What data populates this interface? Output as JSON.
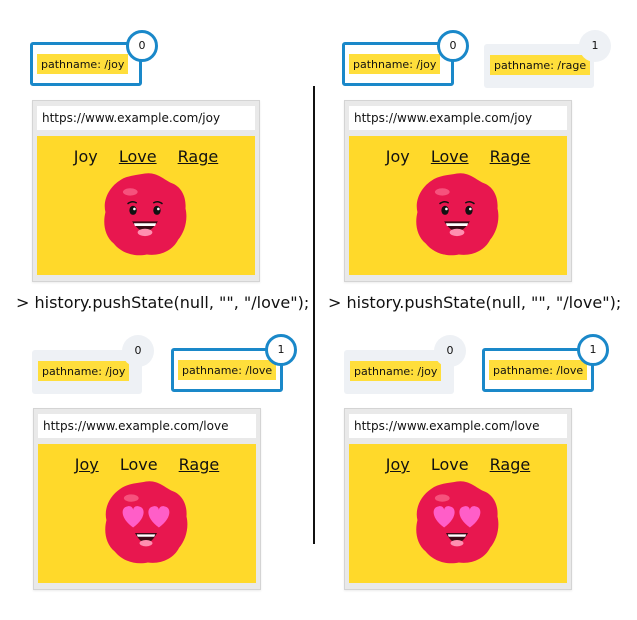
{
  "command": "> history.pushState(null, \"\", \"/love\");",
  "nav": [
    "Joy",
    "Love",
    "Rage"
  ],
  "panels": {
    "tl": {
      "entries": [
        {
          "index": "0",
          "path": "pathname: /joy",
          "active": true
        }
      ],
      "url": "https://www.example.com/joy"
    },
    "tr": {
      "entries": [
        {
          "index": "0",
          "path": "pathname: /joy",
          "active": true
        },
        {
          "index": "1",
          "path": "pathname: /rage",
          "active": false
        }
      ],
      "url": "https://www.example.com/joy"
    },
    "bl": {
      "entries": [
        {
          "index": "0",
          "path": "pathname: /joy",
          "active": false
        },
        {
          "index": "1",
          "path": "pathname: /love",
          "active": true
        }
      ],
      "url": "https://www.example.com/love"
    },
    "br": {
      "entries": [
        {
          "index": "0",
          "path": "pathname: /joy",
          "active": false
        },
        {
          "index": "1",
          "path": "pathname: /love",
          "active": true
        }
      ],
      "url": "https://www.example.com/love"
    }
  },
  "colors": {
    "accent": "#1a88c9",
    "highlight": "#ffde3b",
    "viewport": "#ffd92a",
    "blob": "#e8174f",
    "hearts": "#ff5ec8"
  }
}
